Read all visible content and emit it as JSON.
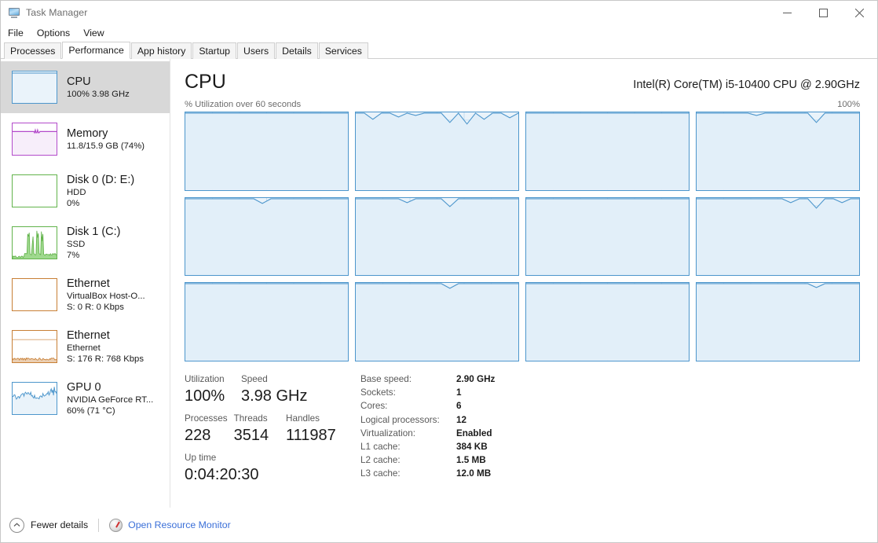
{
  "window": {
    "title": "Task Manager",
    "icon": "task-manager-icon",
    "minimize": "—",
    "maximize": "□",
    "close": "✕"
  },
  "menu": {
    "items": [
      "File",
      "Options",
      "View"
    ]
  },
  "tabs": {
    "items": [
      "Processes",
      "Performance",
      "App history",
      "Startup",
      "Users",
      "Details",
      "Services"
    ],
    "active_index": 1
  },
  "sidebar": {
    "items": [
      {
        "name": "CPU",
        "title": "CPU",
        "sub1": "100% 3.98 GHz",
        "sub2": "",
        "color": "#4d96cc",
        "fill": "#eaf3fa",
        "selected": true,
        "graph": "flat-top"
      },
      {
        "name": "Memory",
        "title": "Memory",
        "sub1": "11.8/15.9 GB (74%)",
        "sub2": "",
        "color": "#b34bca",
        "fill": "#f7eefa",
        "selected": false,
        "graph": "memory"
      },
      {
        "name": "Disk 0",
        "title": "Disk 0 (D: E:)",
        "sub1": "HDD",
        "sub2": "0%",
        "color": "#62b34b",
        "fill": "#ffffff",
        "selected": false,
        "graph": "empty"
      },
      {
        "name": "Disk 1",
        "title": "Disk 1 (C:)",
        "sub1": "SSD",
        "sub2": "7%",
        "color": "#62b34b",
        "fill": "#ffffff",
        "selected": false,
        "graph": "spiky-green"
      },
      {
        "name": "Ethernet VirtualBox",
        "title": "Ethernet",
        "sub1": "VirtualBox Host-O...",
        "sub2": "S: 0 R: 0 Kbps",
        "color": "#c87f35",
        "fill": "#ffffff",
        "selected": false,
        "graph": "empty"
      },
      {
        "name": "Ethernet",
        "title": "Ethernet",
        "sub1": "Ethernet",
        "sub2": "S: 176 R: 768 Kbps",
        "color": "#c87f35",
        "fill": "#ffffff",
        "selected": false,
        "graph": "ethernet"
      },
      {
        "name": "GPU 0",
        "title": "GPU 0",
        "sub1": "NVIDIA GeForce RT...",
        "sub2": "60%  (71 °C)",
        "color": "#4d96cc",
        "fill": "#eaf3fa",
        "selected": false,
        "graph": "gpu"
      }
    ]
  },
  "main": {
    "title": "CPU",
    "model": "Intel(R) Core(TM) i5-10400 CPU @ 2.90GHz",
    "graph_caption": "% Utilization over 60 seconds",
    "graph_max": "100%"
  },
  "chart_data": {
    "type": "line",
    "title": "% Utilization over 60 seconds",
    "ylabel": "% Utilization",
    "xlabel": "60 seconds",
    "ylim": [
      0,
      100
    ],
    "grid": true,
    "legend": "none",
    "graph_count": 12,
    "layout": "4x3",
    "series": [
      {
        "name": "CPU 0",
        "values": [
          100,
          100,
          100,
          100,
          100,
          100,
          100,
          100,
          100,
          100,
          100,
          100,
          100,
          100,
          100,
          100,
          100,
          100,
          100,
          100
        ]
      },
      {
        "name": "CPU 1",
        "values": [
          100,
          100,
          92,
          100,
          100,
          95,
          100,
          97,
          100,
          100,
          100,
          88,
          100,
          86,
          100,
          92,
          100,
          100,
          94,
          100
        ]
      },
      {
        "name": "CPU 2",
        "values": [
          100,
          100,
          100,
          100,
          100,
          100,
          100,
          100,
          100,
          100,
          100,
          100,
          100,
          100,
          100,
          100,
          100,
          100,
          100,
          100
        ]
      },
      {
        "name": "CPU 3",
        "values": [
          100,
          100,
          100,
          100,
          100,
          100,
          100,
          97,
          100,
          100,
          100,
          100,
          100,
          100,
          88,
          100,
          100,
          100,
          100,
          100
        ]
      },
      {
        "name": "CPU 4",
        "values": [
          100,
          100,
          100,
          100,
          100,
          100,
          100,
          100,
          100,
          94,
          100,
          100,
          100,
          100,
          100,
          100,
          100,
          100,
          100,
          100
        ]
      },
      {
        "name": "CPU 5",
        "values": [
          100,
          100,
          100,
          100,
          100,
          100,
          95,
          100,
          100,
          100,
          100,
          90,
          100,
          100,
          100,
          100,
          100,
          100,
          100,
          100
        ]
      },
      {
        "name": "CPU 6",
        "values": [
          100,
          100,
          100,
          100,
          100,
          100,
          100,
          100,
          100,
          100,
          100,
          100,
          100,
          100,
          100,
          100,
          100,
          100,
          100,
          100
        ]
      },
      {
        "name": "CPU 7",
        "values": [
          100,
          100,
          100,
          100,
          100,
          100,
          100,
          100,
          100,
          100,
          100,
          95,
          100,
          100,
          88,
          100,
          100,
          95,
          100,
          100
        ]
      },
      {
        "name": "CPU 8",
        "values": [
          100,
          100,
          100,
          100,
          100,
          100,
          100,
          100,
          100,
          100,
          100,
          100,
          100,
          100,
          100,
          100,
          100,
          100,
          100,
          100
        ]
      },
      {
        "name": "CPU 9",
        "values": [
          100,
          100,
          100,
          100,
          100,
          100,
          100,
          100,
          100,
          100,
          100,
          94,
          100,
          100,
          100,
          100,
          100,
          100,
          100,
          100
        ]
      },
      {
        "name": "CPU 10",
        "values": [
          100,
          100,
          100,
          100,
          100,
          100,
          100,
          100,
          100,
          100,
          100,
          100,
          100,
          100,
          100,
          100,
          100,
          100,
          100,
          100
        ]
      },
      {
        "name": "CPU 11",
        "values": [
          100,
          100,
          100,
          100,
          100,
          100,
          100,
          100,
          100,
          100,
          100,
          100,
          100,
          100,
          95,
          100,
          100,
          100,
          100,
          100
        ]
      }
    ]
  },
  "stats": {
    "utilization_label": "Utilization",
    "utilization_value": "100%",
    "speed_label": "Speed",
    "speed_value": "3.98 GHz",
    "processes_label": "Processes",
    "processes_value": "228",
    "threads_label": "Threads",
    "threads_value": "3514",
    "handles_label": "Handles",
    "handles_value": "111987",
    "uptime_label": "Up time",
    "uptime_value": "0:04:20:30",
    "details": [
      {
        "label": "Base speed:",
        "value": "2.90 GHz"
      },
      {
        "label": "Sockets:",
        "value": "1"
      },
      {
        "label": "Cores:",
        "value": "6"
      },
      {
        "label": "Logical processors:",
        "value": "12"
      },
      {
        "label": "Virtualization:",
        "value": "Enabled"
      },
      {
        "label": "L1 cache:",
        "value": "384 KB"
      },
      {
        "label": "L2 cache:",
        "value": "1.5 MB"
      },
      {
        "label": "L3 cache:",
        "value": "12.0 MB"
      }
    ]
  },
  "footer": {
    "fewer_details": "Fewer details",
    "open_resource_monitor": "Open Resource Monitor"
  }
}
